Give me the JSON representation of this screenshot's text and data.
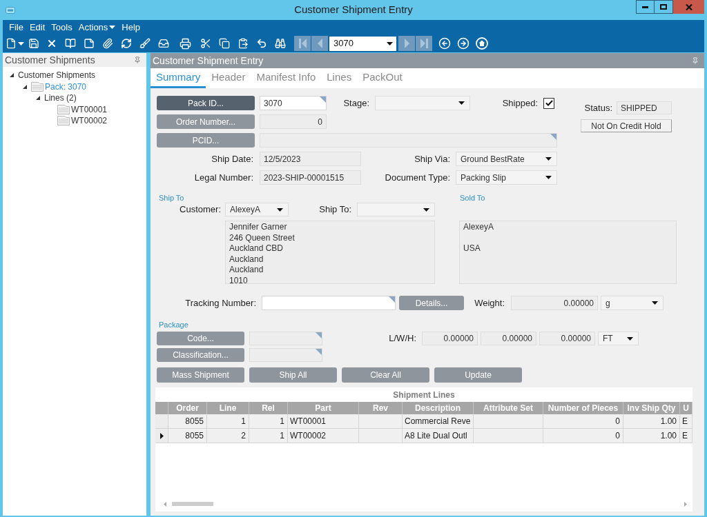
{
  "window": {
    "title": "Customer Shipment Entry"
  },
  "menu_bar": [
    {
      "label": "File",
      "kind": "plain"
    },
    {
      "label": "Edit",
      "kind": "plain"
    },
    {
      "label": "Tools",
      "kind": "plain"
    },
    {
      "label": "Actions",
      "kind": "dropdown"
    },
    {
      "label": "Help",
      "kind": "plain"
    }
  ],
  "toolbar": {
    "record_selector": {
      "value": "3070"
    }
  },
  "tree_panel": {
    "title": "Customer Shipments",
    "tree": [
      {
        "label": "Customer Shipments",
        "has_icon": false,
        "selected": false,
        "expanded": true,
        "children": [
          {
            "label": "Pack: 3070",
            "has_icon": true,
            "selected": true,
            "expanded": true,
            "children": [
              {
                "label": "Lines (2)",
                "has_icon": false,
                "selected": false,
                "expanded": true,
                "children": [
                  {
                    "label": "WT00001",
                    "has_icon": true,
                    "selected": false
                  },
                  {
                    "label": "WT00002",
                    "has_icon": true,
                    "selected": false
                  }
                ]
              }
            ]
          }
        ]
      }
    ]
  },
  "form_panel": {
    "title": "Customer Shipment Entry",
    "tabs": [
      {
        "label": "Summary",
        "selected": true
      },
      {
        "label": "Header",
        "selected": false
      },
      {
        "label": "Manifest Info",
        "selected": false
      },
      {
        "label": "Lines",
        "selected": false
      },
      {
        "label": "PackOut",
        "selected": false
      }
    ],
    "pack_id": {
      "button": "Pack ID...",
      "disabled": false,
      "value": "3070"
    },
    "stage": {
      "label": "Stage:"
    },
    "shipped": {
      "label": "Shipped:",
      "checked": true
    },
    "status": {
      "label": "Status:",
      "value": "SHIPPED"
    },
    "credit_hold_button": {
      "label": "Not On Credit Hold"
    },
    "order_number": {
      "button": "Order Number...",
      "disabled": true,
      "value": "0"
    },
    "pcid": {
      "button": "PCID...",
      "disabled": true
    },
    "ship_date": {
      "label": "Ship Date:",
      "value": "12/5/2023"
    },
    "ship_via": {
      "label": "Ship Via:",
      "value": "Ground BestRate"
    },
    "legal_number": {
      "label": "Legal Number:",
      "value": "2023-SHIP-00001515"
    },
    "document_type": {
      "label": "Document Type:",
      "value": "Packing Slip"
    },
    "ship_to": {
      "heading": "Ship To",
      "customer": {
        "label": "Customer:",
        "value": "AlexeyA"
      },
      "ship_to_field": {
        "label": "Ship To:"
      },
      "address": "Jennifer Garner\n246 Queen Street\nAuckland CBD\nAuckland\nAuckland\n1010"
    },
    "sold_to": {
      "heading": "Sold To",
      "address": "AlexeyA\n\nUSA"
    },
    "tracking_number": {
      "label": "Tracking Number:"
    },
    "details_button": {
      "label": "Details...",
      "disabled": true
    },
    "weight": {
      "label": "Weight:",
      "value": "0.00000",
      "unit": "g"
    },
    "package": {
      "heading": "Package",
      "code": {
        "button": "Code...",
        "disabled": true
      },
      "classification": {
        "button": "Classification...",
        "disabled": true
      },
      "dimensions": {
        "label": "L/W/H:",
        "values": [
          "0.00000",
          "0.00000",
          "0.00000"
        ],
        "unit": "FT"
      }
    },
    "action_buttons": [
      {
        "label": "Mass Shipment",
        "disabled": true
      },
      {
        "label": "Ship All",
        "disabled": true
      },
      {
        "label": "Clear All",
        "disabled": true
      },
      {
        "label": "Update",
        "disabled": true
      }
    ],
    "shipment_lines": {
      "caption": "Shipment Lines",
      "columns": [
        {
          "label": "Order",
          "kind": "number"
        },
        {
          "label": "Line",
          "kind": "number"
        },
        {
          "label": "Rel",
          "kind": "number"
        },
        {
          "label": "Part",
          "kind": "text"
        },
        {
          "label": "Rev",
          "kind": "text"
        },
        {
          "label": "Description",
          "kind": "text"
        },
        {
          "label": "Attribute Set",
          "kind": "text"
        },
        {
          "label": "Number of Pieces",
          "kind": "number"
        },
        {
          "label": "Inv Ship Qty",
          "kind": "number"
        },
        {
          "label": "U",
          "kind": "text"
        }
      ],
      "rows": [
        {
          "selected": false,
          "cells": [
            "8055",
            "1",
            "1",
            "WT00001",
            null,
            "Commercial Reve",
            null,
            "0",
            "1.00",
            "E"
          ]
        },
        {
          "selected": true,
          "cells": [
            "8055",
            "2",
            "1",
            "WT00002",
            null,
            "A8 Lite Dual Outl",
            null,
            "0",
            "1.00",
            "E"
          ]
        }
      ]
    }
  }
}
